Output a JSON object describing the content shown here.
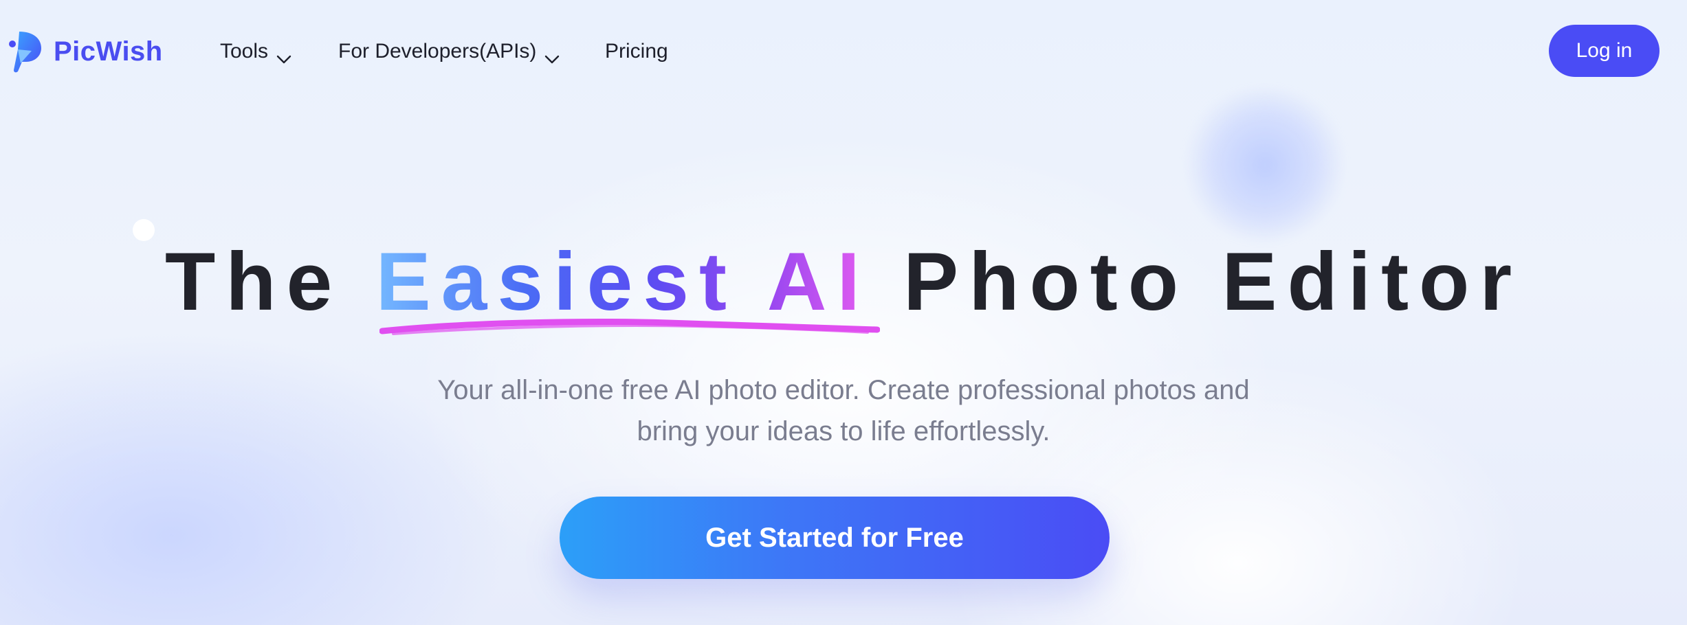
{
  "brand": {
    "name": "PicWish",
    "accent_color": "#4a4df0"
  },
  "nav": {
    "items": [
      {
        "label": "Tools",
        "has_dropdown": true
      },
      {
        "label": "For Developers(APIs)",
        "has_dropdown": true
      },
      {
        "label": "Pricing",
        "has_dropdown": false
      }
    ],
    "login_label": "Log in"
  },
  "hero": {
    "title_before": "The",
    "title_highlight": "Easiest AI",
    "title_after": "Photo Editor",
    "subtitle_line1": "Your all-in-one free AI photo editor. Create professional photos and",
    "subtitle_line2": "bring your ideas to life effortlessly.",
    "cta_label": "Get Started for Free",
    "highlight_underline_color": "#e04ff0"
  }
}
